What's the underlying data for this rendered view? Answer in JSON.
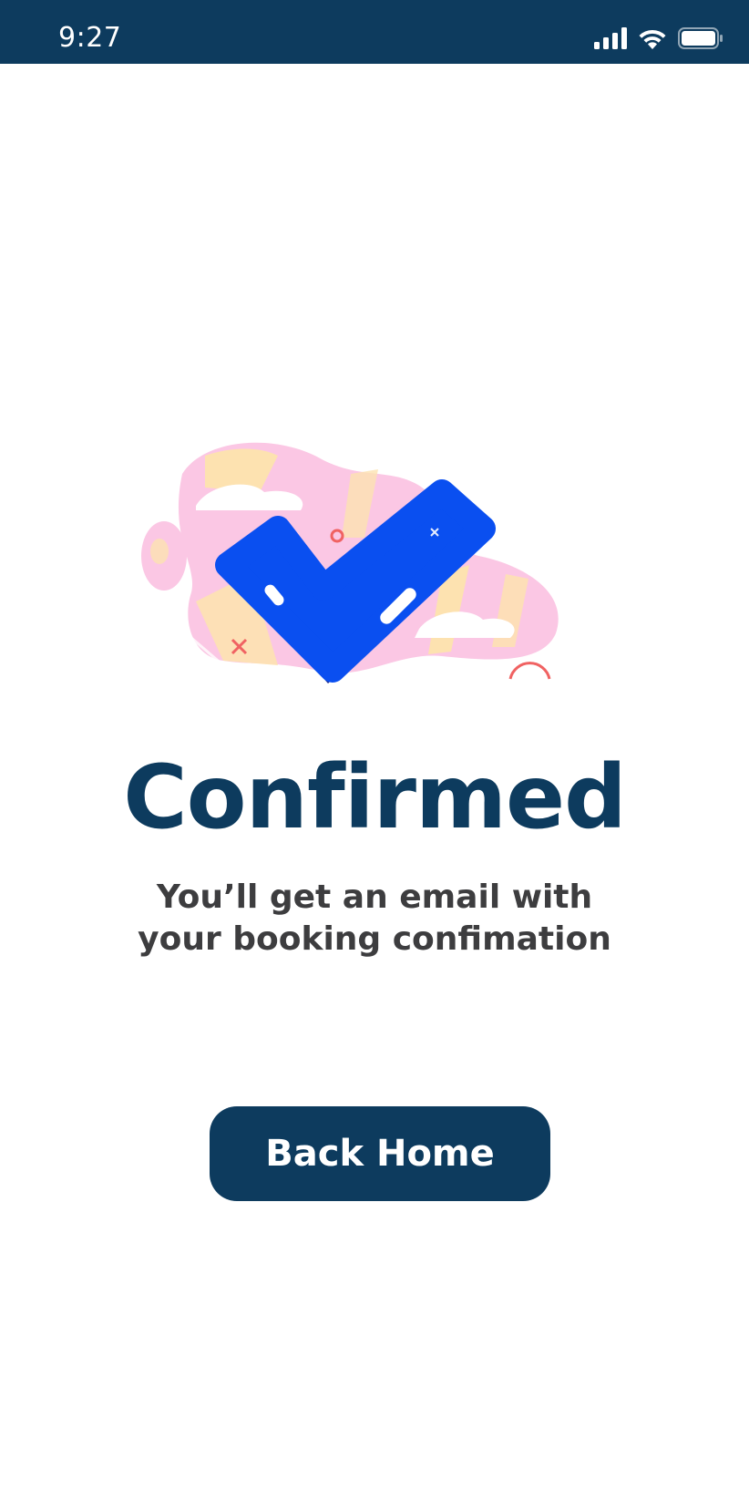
{
  "status_bar": {
    "time": "9:27",
    "icons": [
      "signal-icon",
      "wifi-icon",
      "battery-icon"
    ]
  },
  "illustration": {
    "icon": "checkmark-illustration-icon"
  },
  "confirmation": {
    "title": "Confirmed",
    "message_line1": "You’ll get an email with",
    "message_line2": "your booking confimation"
  },
  "actions": {
    "back_home_label": "Back Home"
  },
  "colors": {
    "primary": "#0d3b5e",
    "text_secondary": "#3d3d3f",
    "check_blue": "#0a4ff0",
    "blob_pink": "#fbc7e4",
    "blob_yellow": "#fde2b0"
  }
}
